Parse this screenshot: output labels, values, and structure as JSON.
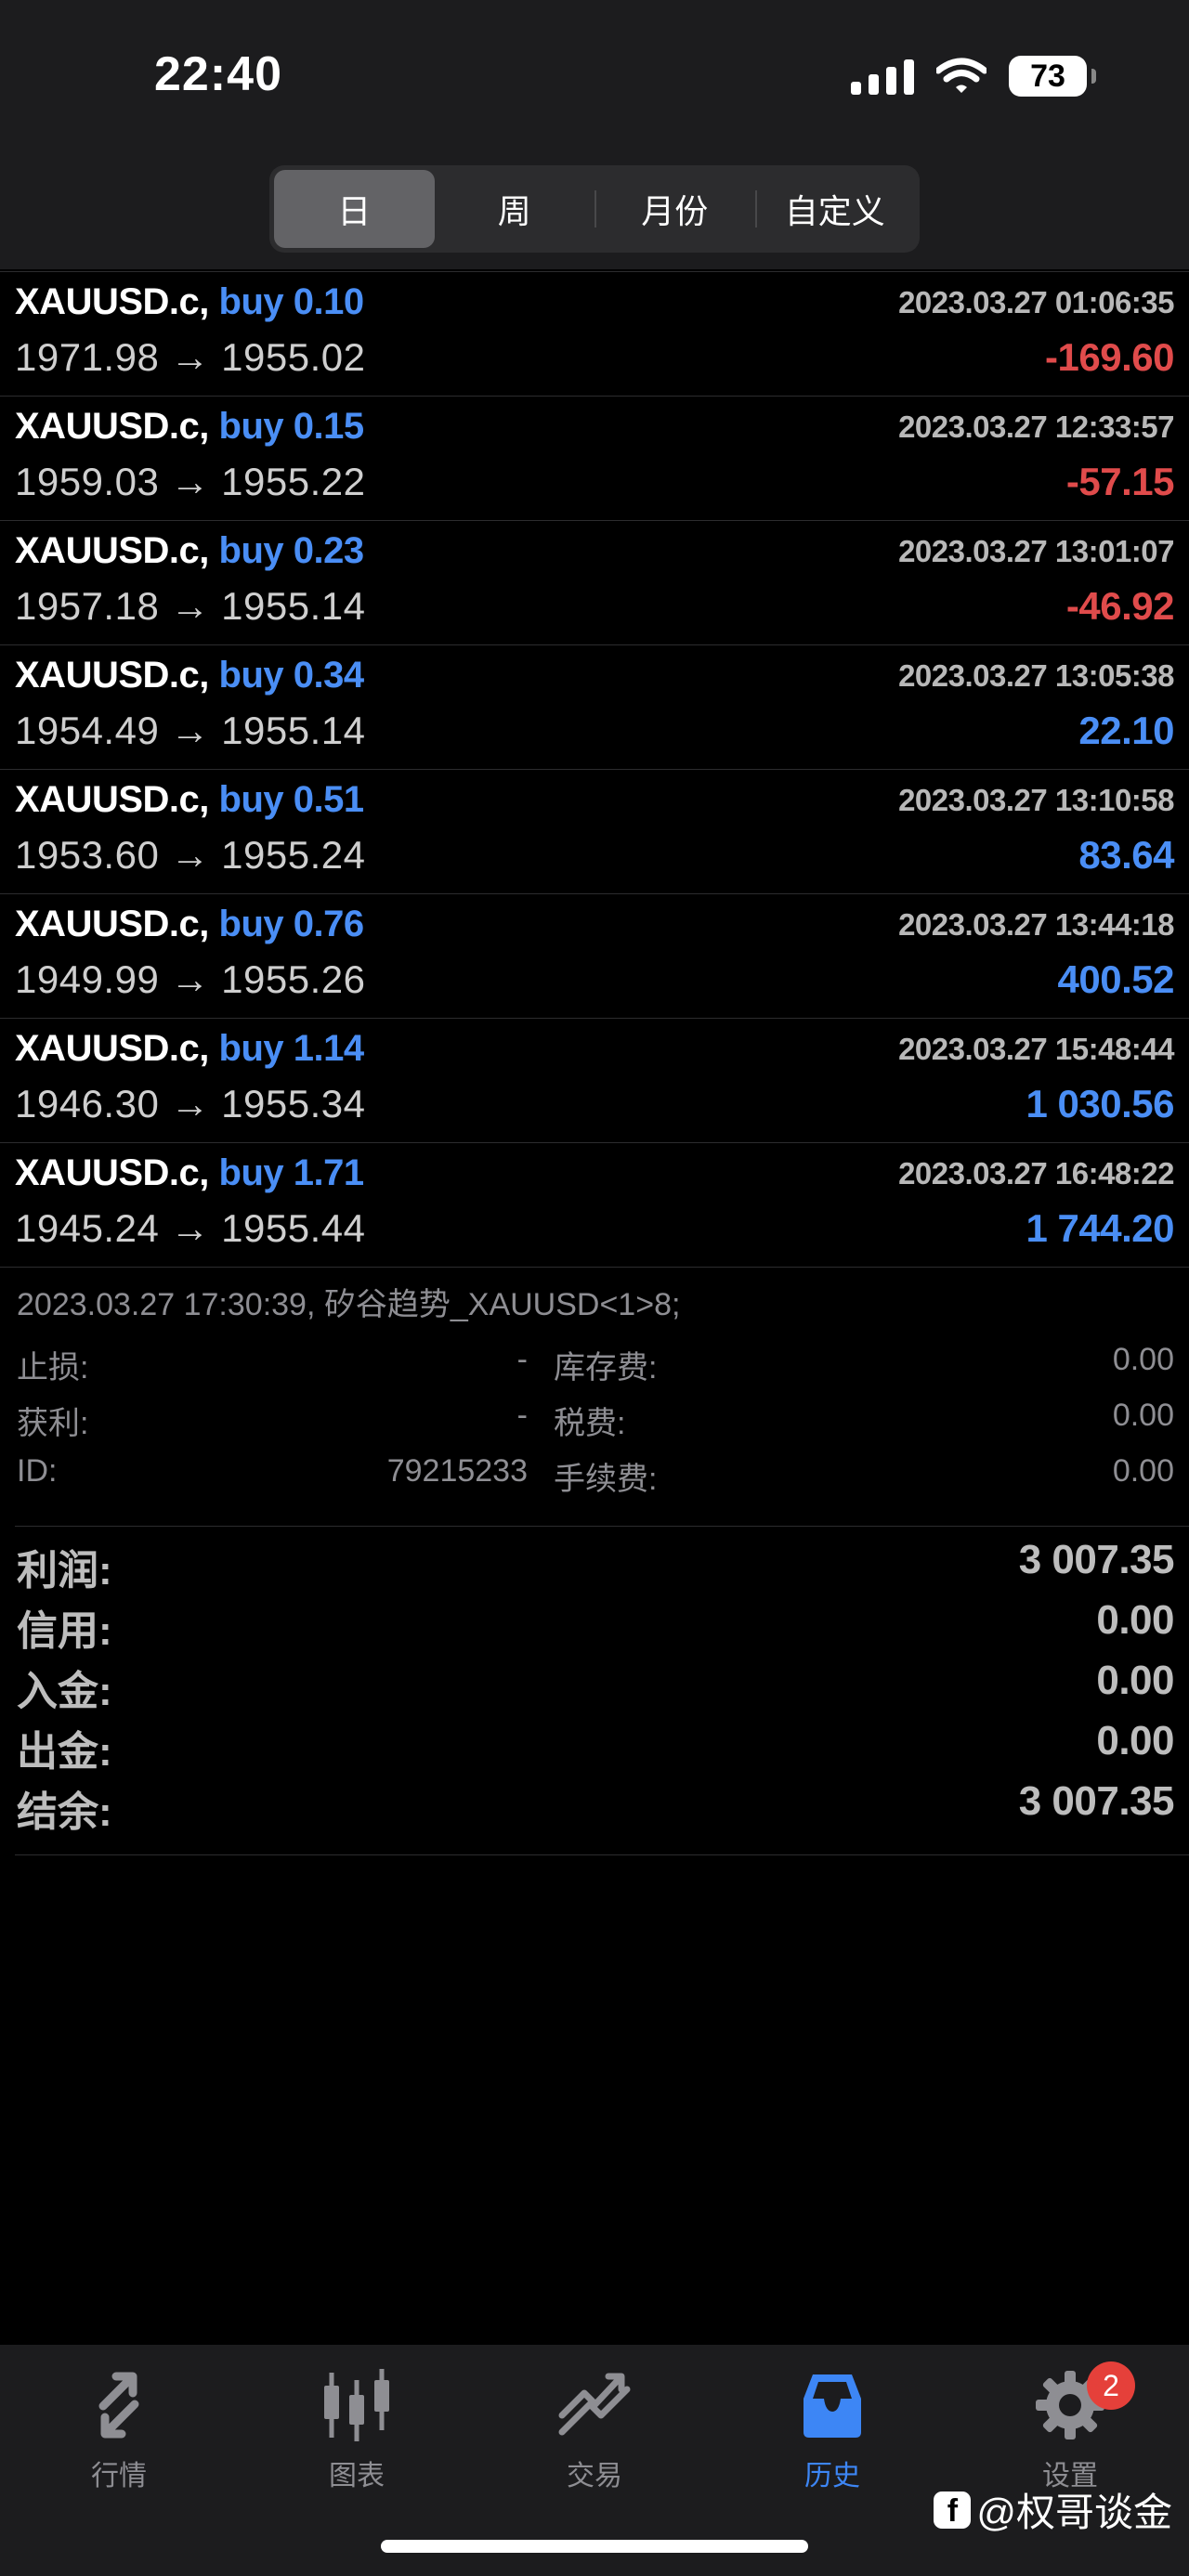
{
  "status": {
    "time": "22:40",
    "battery": "73"
  },
  "period_tabs": [
    {
      "label": "日",
      "active": true
    },
    {
      "label": "周",
      "active": false
    },
    {
      "label": "月份",
      "active": false
    },
    {
      "label": "自定义",
      "active": false
    }
  ],
  "trades": [
    {
      "symbol": "XAUUSD.c,",
      "side_volume": "buy 0.10",
      "time": "2023.03.27 01:06:35",
      "prices": "1971.98 → 1955.02",
      "profit": "-169.60",
      "negative": true
    },
    {
      "symbol": "XAUUSD.c,",
      "side_volume": "buy 0.15",
      "time": "2023.03.27 12:33:57",
      "prices": "1959.03 → 1955.22",
      "profit": "-57.15",
      "negative": true
    },
    {
      "symbol": "XAUUSD.c,",
      "side_volume": "buy 0.23",
      "time": "2023.03.27 13:01:07",
      "prices": "1957.18 → 1955.14",
      "profit": "-46.92",
      "negative": true
    },
    {
      "symbol": "XAUUSD.c,",
      "side_volume": "buy 0.34",
      "time": "2023.03.27 13:05:38",
      "prices": "1954.49 → 1955.14",
      "profit": "22.10",
      "negative": false
    },
    {
      "symbol": "XAUUSD.c,",
      "side_volume": "buy 0.51",
      "time": "2023.03.27 13:10:58",
      "prices": "1953.60 → 1955.24",
      "profit": "83.64",
      "negative": false
    },
    {
      "symbol": "XAUUSD.c,",
      "side_volume": "buy 0.76",
      "time": "2023.03.27 13:44:18",
      "prices": "1949.99 → 1955.26",
      "profit": "400.52",
      "negative": false
    },
    {
      "symbol": "XAUUSD.c,",
      "side_volume": "buy 1.14",
      "time": "2023.03.27 15:48:44",
      "prices": "1946.30 → 1955.34",
      "profit": "1 030.56",
      "negative": false
    },
    {
      "symbol": "XAUUSD.c,",
      "side_volume": "buy 1.71",
      "time": "2023.03.27 16:48:22",
      "prices": "1945.24 → 1955.44",
      "profit": "1 744.20",
      "negative": false
    }
  ],
  "detail": {
    "header": "2023.03.27 17:30:39, 矽谷趋势_XAUUSD<1>8;",
    "rows": [
      {
        "label1": "止损:",
        "value1": "-",
        "label2": "库存费:",
        "value2": "0.00"
      },
      {
        "label1": "获利:",
        "value1": "-",
        "label2": "税费:",
        "value2": "0.00"
      },
      {
        "label1": "ID:",
        "value1": "79215233",
        "label2": "手续费:",
        "value2": "0.00"
      }
    ]
  },
  "summary": [
    {
      "label": "利润:",
      "value": "3 007.35"
    },
    {
      "label": "信用:",
      "value": "0.00"
    },
    {
      "label": "入金:",
      "value": "0.00"
    },
    {
      "label": "出金:",
      "value": "0.00"
    },
    {
      "label": "结余:",
      "value": "3 007.35"
    }
  ],
  "tabbar": [
    {
      "label": "行情",
      "icon": "quotes-arrows-icon",
      "active": false
    },
    {
      "label": "图表",
      "icon": "candlestick-chart-icon",
      "active": false
    },
    {
      "label": "交易",
      "icon": "trade-chart-icon",
      "active": false
    },
    {
      "label": "历史",
      "icon": "history-inbox-icon",
      "active": true
    },
    {
      "label": "设置",
      "icon": "gear-icon",
      "active": false,
      "badge": "2"
    }
  ],
  "watermark": "@权哥谈金",
  "colors": {
    "positive": "#4a8ef5",
    "negative": "#e04b4b",
    "active_tab": "#3d86f5",
    "badge": "#e5403a"
  }
}
